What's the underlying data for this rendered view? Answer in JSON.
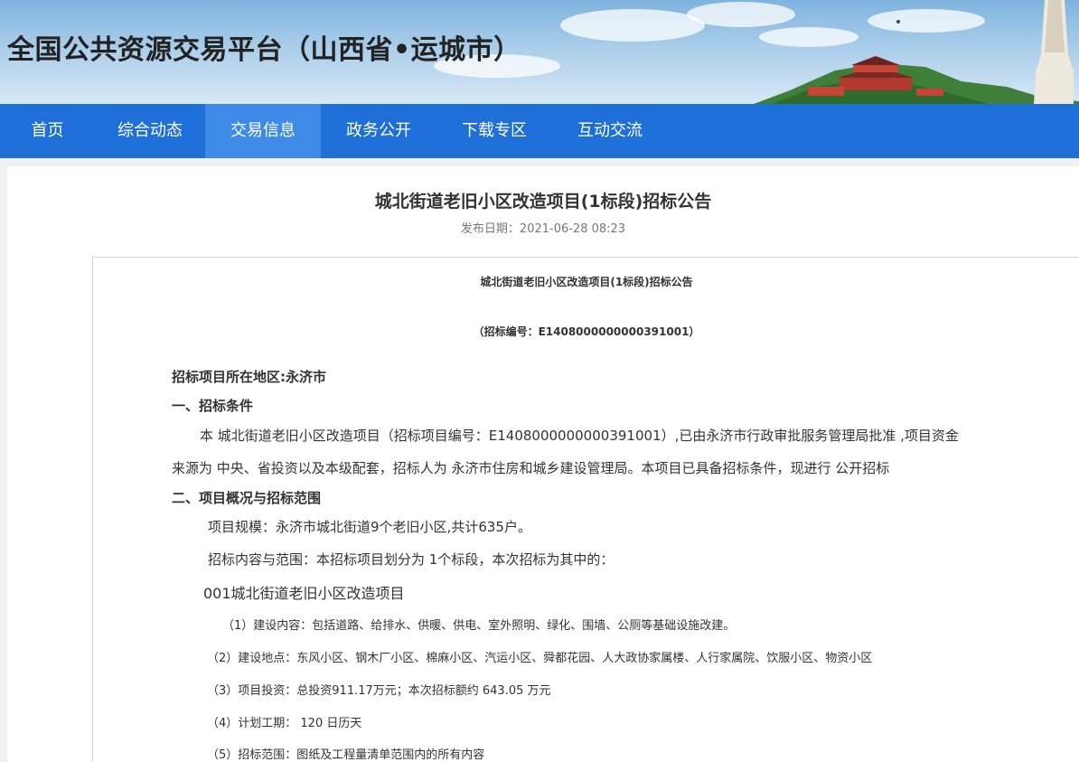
{
  "header": {
    "site_title": "全国公共资源交易平台（山西省•运城市）"
  },
  "nav": {
    "items": [
      "首页",
      "综合动态",
      "交易信息",
      "政务公开",
      "下载专区",
      "互动交流"
    ],
    "active_index": 2
  },
  "article": {
    "title": "城北街道老旧小区改造项目(1标段)招标公告",
    "publish_date": "发布日期：2021-06-28 08:23",
    "doc_title": "城北街道老旧小区改造项目(1标段)招标公告",
    "doc_code": "（招标编号：E1408000000000391001）",
    "region": "招标项目所在地区:永济市",
    "section1_heading": "一、招标条件",
    "section1_line1": "本 城北街道老旧小区改造项目（招标项目编号：E1408000000000391001）,已由永济市行政审批服务管理局批准 ,项目资金",
    "section1_line2": "来源为 中央、省投资以及本级配套，招标人为 永济市住房和城乡建设管理局。本项目已具备招标条件，现进行 公开招标",
    "section2_heading": "二、项目概况与招标范围",
    "scale": "项目规模：永济市城北街道9个老旧小区,共计635户。",
    "scope": "招标内容与范围：本招标项目划分为 1个标段，本次招标为其中的：",
    "lot": "001城北街道老旧小区改造项目",
    "items": [
      "（1）建设内容：包括道路、给排水、供暖、供电、室外照明、绿化、围墙、公厕等基础设施改建。",
      "（2）建设地点：东风小区、钢木厂小区、棉麻小区、汽运小区、舜都花园、人大政协家属楼、人行家属院、饮服小区、物资小区",
      "（3）项目投资：总投资911.17万元；本次招标额约 643.05 万元",
      "（4）计划工期： 120 日历天",
      "（5）招标范围：图纸及工程量清单范围内的所有内容"
    ]
  }
}
